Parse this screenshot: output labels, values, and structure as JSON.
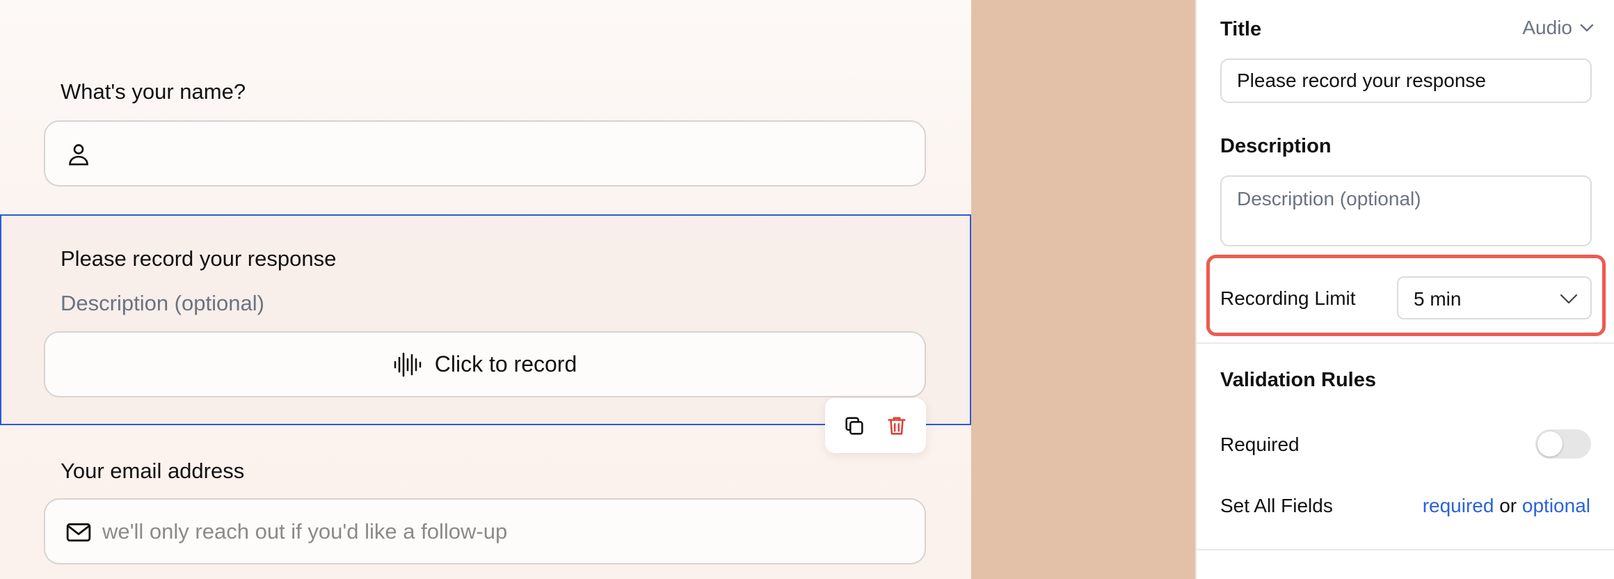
{
  "form": {
    "name_question": {
      "label": "What's your name?",
      "icon": "person-icon",
      "placeholder": ""
    },
    "audio_question": {
      "label": "Please record your response",
      "description": "Description (optional)",
      "record_label": "Click to record",
      "record_icon": "audio-wave-icon"
    },
    "email_question": {
      "label": "Your email address",
      "icon": "mail-icon",
      "placeholder": "we'll only reach out if you'd like a follow-up"
    },
    "block_actions": {
      "duplicate_icon": "copy-icon",
      "delete_icon": "trash-icon"
    }
  },
  "panel": {
    "title_label": "Title",
    "field_type": "Audio",
    "title_value": "Please record your response",
    "description_label": "Description",
    "description_placeholder": "Description (optional)",
    "recording_limit_label": "Recording Limit",
    "recording_limit_value": "5 min",
    "validation_label": "Validation Rules",
    "required_label": "Required",
    "required_on": false,
    "set_all_label": "Set All Fields",
    "set_all_required": "required",
    "set_all_or": "or",
    "set_all_optional": "optional"
  },
  "colors": {
    "accent_blue": "#2a5bd7",
    "highlight_red": "#ef5a4f",
    "delete_red": "#e0403a",
    "backdrop": "#e3c1a8"
  }
}
